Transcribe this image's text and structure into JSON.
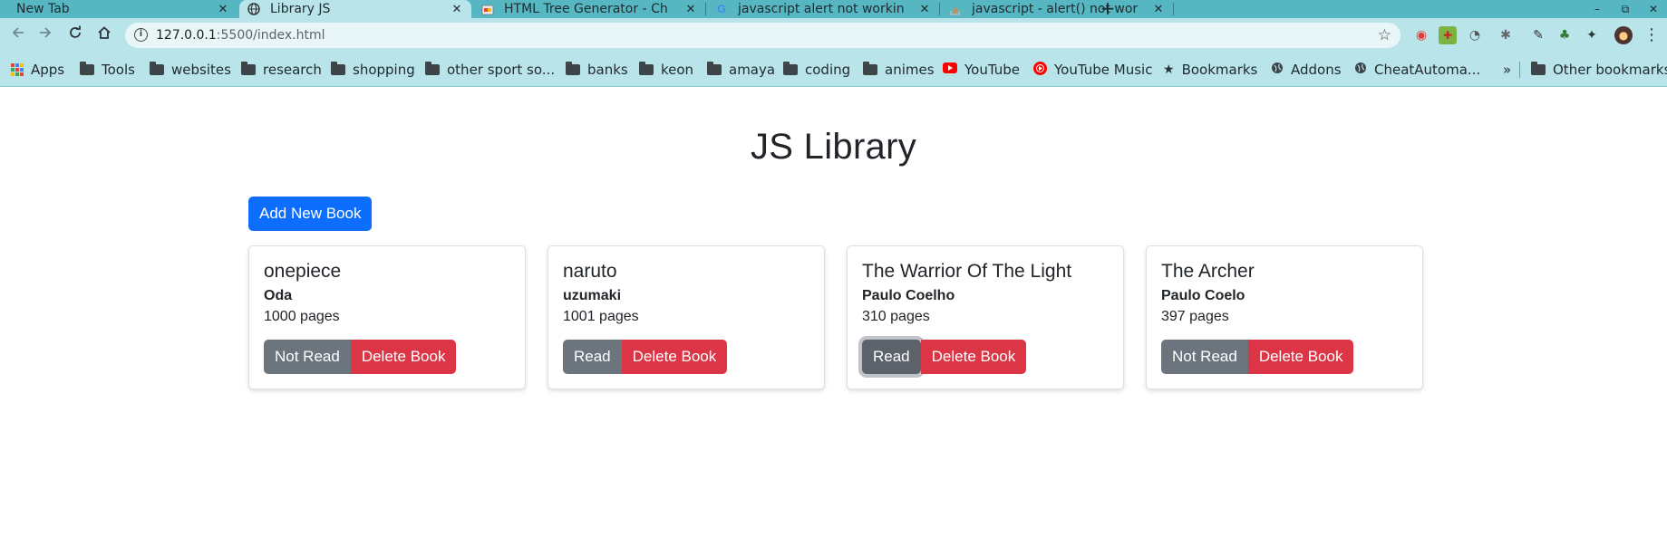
{
  "browser": {
    "tabs": [
      {
        "title": "New Tab",
        "favicon": "",
        "active": false
      },
      {
        "title": "Library JS",
        "favicon": "globe-icon",
        "active": true
      },
      {
        "title": "HTML Tree Generator - Ch",
        "favicon": "chrome-store-icon",
        "active": false
      },
      {
        "title": "javascript alert not workin",
        "favicon": "google-icon",
        "active": false
      },
      {
        "title": "javascript - alert() not wor",
        "favicon": "stackoverflow-icon",
        "active": false
      }
    ],
    "tab_close_glyph": "✕",
    "new_tab_glyph": "+",
    "url_host": "127.0.0.1",
    "url_path": ":5500/index.html",
    "bookmarks": [
      {
        "label": "Apps",
        "icon": "apps-grid-icon"
      },
      {
        "label": "Tools",
        "icon": "folder-icon"
      },
      {
        "label": "websites",
        "icon": "folder-icon"
      },
      {
        "label": "research",
        "icon": "folder-icon"
      },
      {
        "label": "shopping",
        "icon": "folder-icon"
      },
      {
        "label": "other sport so...",
        "icon": "folder-icon"
      },
      {
        "label": "banks",
        "icon": "folder-icon"
      },
      {
        "label": "keon",
        "icon": "folder-icon"
      },
      {
        "label": "amaya",
        "icon": "folder-icon"
      },
      {
        "label": "coding",
        "icon": "folder-icon"
      },
      {
        "label": "animes",
        "icon": "folder-icon"
      },
      {
        "label": "YouTube",
        "icon": "youtube-icon"
      },
      {
        "label": "YouTube Music",
        "icon": "youtube-music-icon"
      },
      {
        "label": "Bookmarks",
        "icon": "star-icon"
      },
      {
        "label": "Addons",
        "icon": "globe-icon"
      },
      {
        "label": "CheatAutoma...",
        "icon": "globe-icon"
      }
    ],
    "bookmarks_overflow": "»",
    "other_bookmarks": "Other bookmarks"
  },
  "page": {
    "title": "JS Library",
    "add_button": "Add New Book",
    "books": [
      {
        "title": "onepiece",
        "author": "Oda",
        "pages": "1000 pages",
        "read_label": "Not Read",
        "delete_label": "Delete Book",
        "read_focused": false
      },
      {
        "title": "naruto",
        "author": "uzumaki",
        "pages": "1001 pages",
        "read_label": "Read",
        "delete_label": "Delete Book",
        "read_focused": false
      },
      {
        "title": "The Warrior Of The Light",
        "author": "Paulo Coelho",
        "pages": "310 pages",
        "read_label": "Read",
        "delete_label": "Delete Book",
        "read_focused": true
      },
      {
        "title": "The Archer",
        "author": "Paulo Coelo",
        "pages": "397 pages",
        "read_label": "Not Read",
        "delete_label": "Delete Book",
        "read_focused": false
      }
    ]
  },
  "colors": {
    "tabstrip": "#56b6c2",
    "toolbar": "#b9e4ea",
    "primary": "#0d6efd",
    "secondary": "#6c757d",
    "danger": "#dc3545"
  }
}
